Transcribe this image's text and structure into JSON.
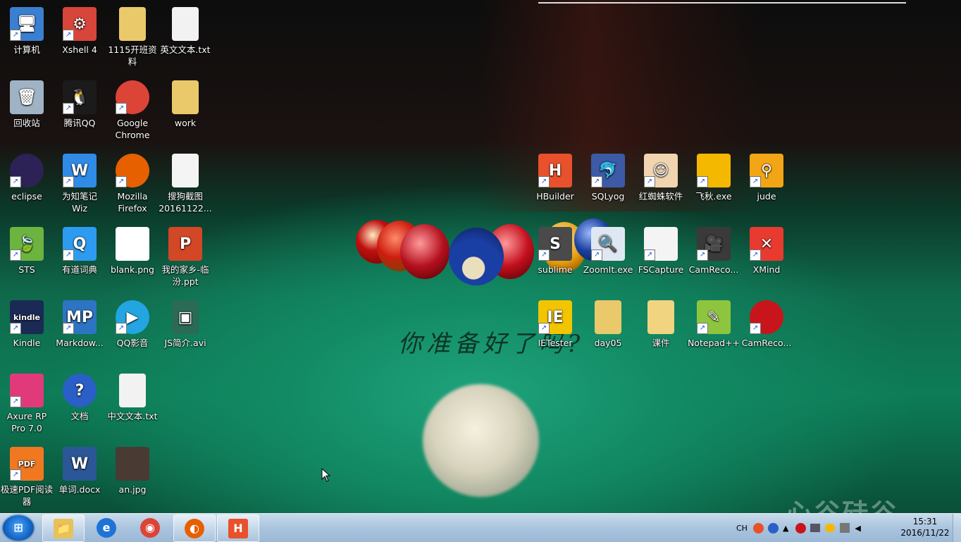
{
  "desktop": {
    "icons": [
      {
        "label": "计算机",
        "shape": "computer-icon",
        "glyph": "🖥",
        "bg": "#3a7fd0"
      },
      {
        "label": "Xshell 4",
        "shape": "xshell-icon",
        "glyph": "⚙",
        "bg": "#d8453a"
      },
      {
        "label": "1115开班资料",
        "shape": "folder-icon",
        "glyph": "",
        "bg": "#e9c96a"
      },
      {
        "label": "英文文本.txt",
        "shape": "text-file-icon",
        "glyph": "",
        "bg": "#f2f2f2"
      },
      {
        "label": "回收站",
        "shape": "recycle-bin-icon",
        "glyph": "🗑",
        "bg": "#9fb3c4"
      },
      {
        "label": "腾讯QQ",
        "shape": "qq-penguin-icon",
        "glyph": "🐧",
        "bg": "#1b1b1b"
      },
      {
        "label": "Google Chrome",
        "shape": "chrome-icon",
        "glyph": "",
        "bg": "#db4437"
      },
      {
        "label": "work",
        "shape": "folder-icon",
        "glyph": "",
        "bg": "#e9c96a"
      },
      {
        "label": "eclipse",
        "shape": "eclipse-icon",
        "glyph": "",
        "bg": "#2c2255"
      },
      {
        "label": "为知笔记 Wiz",
        "shape": "wiz-icon",
        "glyph": "W",
        "bg": "#2f8be6"
      },
      {
        "label": "Mozilla Firefox",
        "shape": "firefox-icon",
        "glyph": "",
        "bg": "#e66000"
      },
      {
        "label": "搜狗截图 20161122...",
        "shape": "image-file-icon",
        "glyph": "",
        "bg": "#f4f4f4"
      },
      {
        "label": "STS",
        "shape": "spring-leaf-icon",
        "glyph": "🍃",
        "bg": "#6db33f"
      },
      {
        "label": "有道词典",
        "shape": "youdao-icon",
        "glyph": "Q",
        "bg": "#2d9cf0"
      },
      {
        "label": "blank.png",
        "shape": "blank-image-icon",
        "glyph": "",
        "bg": "#ffffff"
      },
      {
        "label": "我的家乡-临汾.ppt",
        "shape": "powerpoint-icon",
        "glyph": "P",
        "bg": "#d24726"
      },
      {
        "label": "Kindle",
        "shape": "kindle-icon",
        "glyph": "kindle",
        "bg": "#1a2a55"
      },
      {
        "label": "Markdow...",
        "shape": "markdownpad-icon",
        "glyph": "MP",
        "bg": "#2d74c4"
      },
      {
        "label": "QQ影音",
        "shape": "qq-player-icon",
        "glyph": "▶",
        "bg": "#22a5e0"
      },
      {
        "label": "JS简介.avi",
        "shape": "video-file-icon",
        "glyph": "▣",
        "bg": "#2b6a55"
      },
      {
        "label": "Axure RP Pro 7.0",
        "shape": "axure-icon",
        "glyph": "",
        "bg": "#e03a7a"
      },
      {
        "label": "文档",
        "shape": "help-icon",
        "glyph": "?",
        "bg": "#2a5fc8"
      },
      {
        "label": "中文文本.txt",
        "shape": "text-file-icon",
        "glyph": "",
        "bg": "#f2f2f2"
      },
      {
        "label": "极速PDF阅读器",
        "shape": "pdf-reader-icon",
        "glyph": "PDF",
        "bg": "#f07820"
      },
      {
        "label": "单词.docx",
        "shape": "word-doc-icon",
        "glyph": "W",
        "bg": "#2b5797"
      },
      {
        "label": "an.jpg",
        "shape": "photo-icon",
        "glyph": "",
        "bg": "#4a3a34"
      },
      {
        "label": "HBuilder",
        "shape": "hbuilder-icon",
        "glyph": "H",
        "bg": "#e8512b"
      },
      {
        "label": "SQLyog",
        "shape": "sqlyog-dolphin-icon",
        "glyph": "🐬",
        "bg": "#3c5aa6"
      },
      {
        "label": "红蜘蛛软件",
        "shape": "avatar-icon",
        "glyph": "☺",
        "bg": "#f1d4b0"
      },
      {
        "label": "飞秋.exe",
        "shape": "feiq-chat-icon",
        "glyph": "",
        "bg": "#f5b800"
      },
      {
        "label": "jude",
        "shape": "jude-icon",
        "glyph": "⚲",
        "bg": "#f2a515"
      },
      {
        "label": "sublime",
        "shape": "sublime-icon",
        "glyph": "S",
        "bg": "#4a4a4a"
      },
      {
        "label": "ZoomIt.exe",
        "shape": "zoomit-icon",
        "glyph": "🔍",
        "bg": "#dfe8f2"
      },
      {
        "label": "FSCapture",
        "shape": "fscapture-icon",
        "glyph": "",
        "bg": "#f4f4f4"
      },
      {
        "label": "CamReco...",
        "shape": "camera-icon",
        "glyph": "🎥",
        "bg": "#3a3a3a"
      },
      {
        "label": "XMind",
        "shape": "xmind-icon",
        "glyph": "✕",
        "bg": "#e83a2f"
      },
      {
        "label": "IETester",
        "shape": "ietester-icon",
        "glyph": "IE",
        "bg": "#f2c500"
      },
      {
        "label": "day05",
        "shape": "folder-icon",
        "glyph": "",
        "bg": "#e9c96a"
      },
      {
        "label": "课件",
        "shape": "folder-icon",
        "glyph": "",
        "bg": "#f0d480"
      },
      {
        "label": "Notepad++",
        "shape": "notepad-plus-icon",
        "glyph": "✎",
        "bg": "#8ec53f"
      },
      {
        "label": "CamReco...",
        "shape": "camrec-red-icon",
        "glyph": "",
        "bg": "#c8151b"
      }
    ],
    "slogan": "你准备好了吗?",
    "watermark": "心谷硅谷"
  },
  "taskbar": {
    "start_label": "⊞",
    "pinned": [
      {
        "name": "explorer",
        "shape": "explorer-folder-icon",
        "glyph": "📁"
      },
      {
        "name": "ie",
        "shape": "internet-explorer-icon",
        "glyph": "e"
      },
      {
        "name": "chrome",
        "shape": "chrome-icon",
        "glyph": "◉"
      },
      {
        "name": "firefox",
        "shape": "firefox-icon",
        "glyph": "◐"
      },
      {
        "name": "hbuilder",
        "shape": "hbuilder-icon",
        "glyph": "H"
      }
    ],
    "tray": {
      "lang": "CH",
      "time": "15:31",
      "date": "2016/11/22"
    }
  }
}
